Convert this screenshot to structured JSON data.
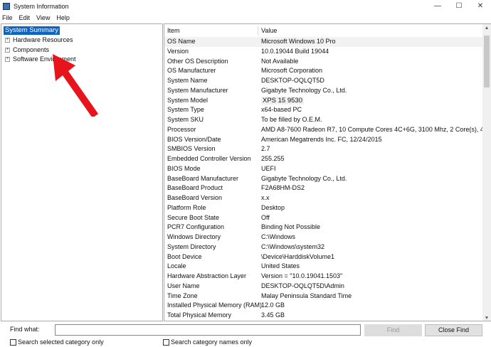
{
  "window": {
    "title": "System Information"
  },
  "menu": [
    "File",
    "Edit",
    "View",
    "Help"
  ],
  "tree": {
    "selected": "System Summary",
    "items": [
      "Hardware Resources",
      "Components",
      "Software Environment"
    ]
  },
  "table": {
    "headers": [
      "Item",
      "Value"
    ],
    "rows": [
      [
        "OS Name",
        "Microsoft Windows 10 Pro"
      ],
      [
        "Version",
        "10.0.19044 Build 19044"
      ],
      [
        "Other OS Description",
        "Not Available"
      ],
      [
        "OS Manufacturer",
        "Microsoft Corporation"
      ],
      [
        "System Name",
        "DESKTOP-OQLQT5D"
      ],
      [
        "System Manufacturer",
        "Gigabyte Technology Co., Ltd."
      ],
      [
        "System Model",
        "XPS 15 9530"
      ],
      [
        "System Type",
        "x64-based PC"
      ],
      [
        "System SKU",
        "To be filled by O.E.M."
      ],
      [
        "Processor",
        "AMD A8-7600 Radeon R7, 10 Compute Cores 4C+6G, 3100 Mhz, 2 Core(s), 4 ..."
      ],
      [
        "BIOS Version/Date",
        "American Megatrends Inc. FC, 12/24/2015"
      ],
      [
        "SMBIOS Version",
        "2.7"
      ],
      [
        "Embedded Controller Version",
        "255.255"
      ],
      [
        "BIOS Mode",
        "UEFI"
      ],
      [
        "BaseBoard Manufacturer",
        "Gigabyte Technology Co., Ltd."
      ],
      [
        "BaseBoard Product",
        "F2A68HM-DS2"
      ],
      [
        "BaseBoard Version",
        "x.x"
      ],
      [
        "Platform Role",
        "Desktop"
      ],
      [
        "Secure Boot State",
        "Off"
      ],
      [
        "PCR7 Configuration",
        "Binding Not Possible"
      ],
      [
        "Windows Directory",
        "C:\\Windows"
      ],
      [
        "System Directory",
        "C:\\Windows\\system32"
      ],
      [
        "Boot Device",
        "\\Device\\HarddiskVolume1"
      ],
      [
        "Locale",
        "United States"
      ],
      [
        "Hardware Abstraction Layer",
        "Version = \"10.0.19041.1503\""
      ],
      [
        "User Name",
        "DESKTOP-OQLQT5D\\Admin"
      ],
      [
        "Time Zone",
        "Malay Peninsula Standard Time"
      ],
      [
        "Installed Physical Memory (RAM)",
        "12.0 GB"
      ],
      [
        "Total Physical Memory",
        "3.45 GB"
      ]
    ]
  },
  "find": {
    "label": "Find what:",
    "value": "",
    "find_button": "Find",
    "close_button": "Close Find",
    "check1": "Search selected category only",
    "check2": "Search category names only"
  },
  "colors": {
    "selection": "#0a64c8",
    "annotation_arrow": "#e8141b"
  }
}
